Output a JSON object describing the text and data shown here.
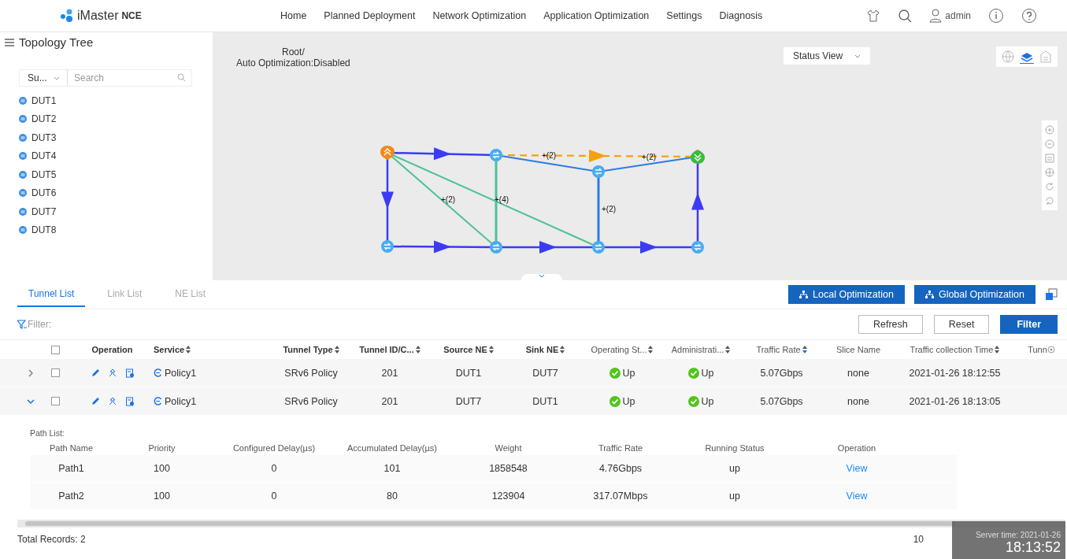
{
  "header": {
    "logo": {
      "name": "iMaster",
      "suffix": "NCE"
    },
    "nav": [
      {
        "label": "Home"
      },
      {
        "label": "Planned Deployment"
      },
      {
        "label": "Network Optimization"
      },
      {
        "label": "Application Optimization"
      },
      {
        "label": "Settings"
      },
      {
        "label": "Diagnosis"
      }
    ],
    "user": "admin"
  },
  "sidebar": {
    "title": "Topology Tree",
    "filter": {
      "value": "Su..."
    },
    "search": {
      "placeholder": "Search"
    },
    "items": [
      "DUT1",
      "DUT2",
      "DUT3",
      "DUT4",
      "DUT5",
      "DUT6",
      "DUT7",
      "DUT8"
    ]
  },
  "topology": {
    "path": "Root/",
    "auto_optimization": "Auto Optimization:Disabled",
    "view": "Status View",
    "view_modes": [
      {
        "selected": false
      },
      {
        "selected": true
      },
      {
        "selected": false
      }
    ],
    "nodes": [
      {
        "kind": "source"
      },
      {
        "kind": "router"
      },
      {
        "kind": "router"
      },
      {
        "kind": "sink"
      },
      {
        "kind": "router"
      },
      {
        "kind": "router"
      },
      {
        "kind": "router"
      },
      {
        "kind": "router"
      }
    ],
    "edge_labels": [
      "+(2)",
      "+(4)",
      "+(2)",
      "+(2)",
      "+(2)"
    ]
  },
  "tabs": [
    {
      "label": "Tunnel List",
      "selected": true
    },
    {
      "label": "Link List",
      "selected": false
    },
    {
      "label": "NE List",
      "selected": false
    }
  ],
  "actions": [
    "Local Optimization",
    "Global Optimization"
  ],
  "filter": {
    "label": "Filter:",
    "buttons": [
      {
        "label": "Refresh",
        "kind": "secondary"
      },
      {
        "label": "Reset",
        "kind": "secondary"
      },
      {
        "label": "Filter",
        "kind": "primary"
      }
    ]
  },
  "table": {
    "header_checked": false,
    "columns": [
      {
        "label": "Operation"
      },
      {
        "label": "Service",
        "sorted": false
      },
      {
        "label": "Tunnel Type",
        "sorted": false
      },
      {
        "label": "Tunnel ID/C...",
        "sorted": false
      },
      {
        "label": "Source NE",
        "sorted": false
      },
      {
        "label": "Sink NE",
        "sorted": false
      },
      {
        "label": "Operating St...",
        "sorted": false
      },
      {
        "label": "Administrati...",
        "sorted": false
      },
      {
        "label": "Traffic Rate",
        "sorted": true
      },
      {
        "label": "Slice Name"
      },
      {
        "label": "Traffic collection Time",
        "sorted": false
      },
      {
        "label": "Tunn"
      }
    ],
    "rows": [
      {
        "expanded": false,
        "checked": false,
        "service": "Policy1",
        "tunnel_type": "SRv6 Policy",
        "tunnel_id": "201",
        "source_ne": "DUT1",
        "sink_ne": "DUT7",
        "operating_status": {
          "kind": "up",
          "label": "Up"
        },
        "admin_status": {
          "kind": "up",
          "label": "Up"
        },
        "traffic_rate": "5.07Gbps",
        "slice_name": "none",
        "collection_time": "2021-01-26 18:12:55"
      },
      {
        "expanded": true,
        "checked": false,
        "service": "Policy1",
        "tunnel_type": "SRv6 Policy",
        "tunnel_id": "201",
        "source_ne": "DUT7",
        "sink_ne": "DUT1",
        "operating_status": {
          "kind": "up",
          "label": "Up"
        },
        "admin_status": {
          "kind": "up",
          "label": "Up"
        },
        "traffic_rate": "5.07Gbps",
        "slice_name": "none",
        "collection_time": "2021-01-26 18:13:05"
      }
    ]
  },
  "path_list": {
    "title": "Path List:",
    "columns": [
      "Path Name",
      "Priority",
      "Configured Delay(µs)",
      "Accumulated Delay(µs)",
      "Weight",
      "Traffic Rate",
      "Running Status",
      "Operation"
    ],
    "rows": [
      {
        "cells": [
          "Path1",
          "100",
          "0",
          "101",
          "1858548",
          "4.76Gbps",
          "up"
        ],
        "action": "View"
      },
      {
        "cells": [
          "Path2",
          "100",
          "0",
          "80",
          "123904",
          "317.07Mbps",
          "up"
        ],
        "action": "View"
      }
    ]
  },
  "footer": {
    "total": "Total Records: 2",
    "page_size": "10"
  },
  "server_time": {
    "label": "Server time: 2021-01-26",
    "time": "18:13:52"
  }
}
